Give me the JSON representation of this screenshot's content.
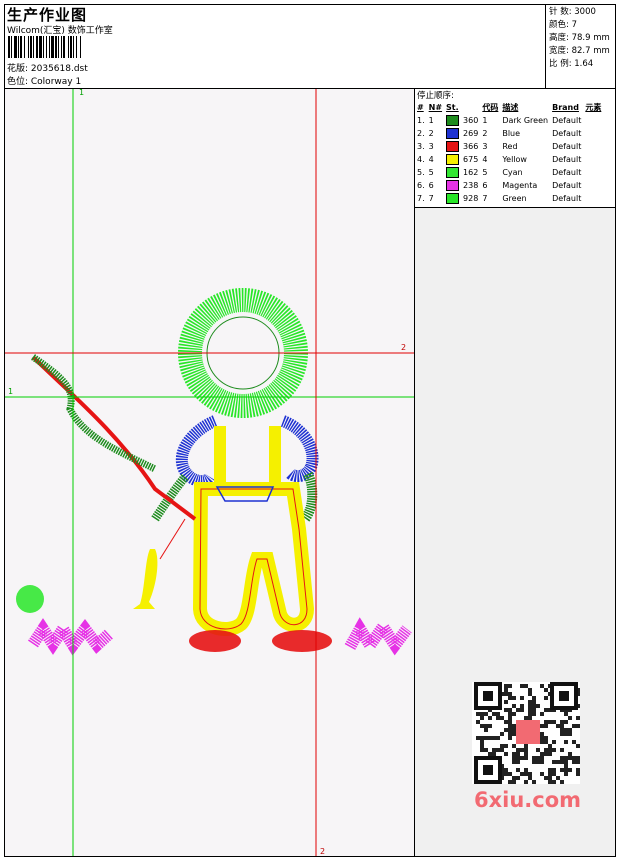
{
  "header": {
    "title": "生产作业图",
    "subtitle": "Wilcom(汇宝) 数饰工作室",
    "design_label": "花版: 2035618.dst",
    "colorway_label": "色位:  Colorway 1"
  },
  "stats": {
    "stitches": "针 数:  3000",
    "colors": "颜色:  7",
    "height": "高度:  78.9 mm",
    "width": "宽度:  82.7 mm",
    "ratio": "比 例:  1.64"
  },
  "panel": {
    "title": "停止顺序:",
    "headers": [
      "#",
      "N#",
      "St.",
      "代码",
      "描述",
      "Brand",
      "元素"
    ],
    "rows": [
      {
        "num": "1.",
        "n": "1",
        "st": "360",
        "code": "1",
        "desc": "Dark Green",
        "brand": "Default",
        "color": "#1e8c1e"
      },
      {
        "num": "2.",
        "n": "2",
        "st": "269",
        "code": "2",
        "desc": "Blue",
        "brand": "Default",
        "color": "#1e32d2"
      },
      {
        "num": "3.",
        "n": "3",
        "st": "366",
        "code": "3",
        "desc": "Red",
        "brand": "Default",
        "color": "#e61414"
      },
      {
        "num": "4.",
        "n": "4",
        "st": "675",
        "code": "4",
        "desc": "Yellow",
        "brand": "Default",
        "color": "#f5f000"
      },
      {
        "num": "5.",
        "n": "5",
        "st": "162",
        "code": "5",
        "desc": "Cyan",
        "brand": "Default",
        "color": "#32e632"
      },
      {
        "num": "6.",
        "n": "6",
        "st": "238",
        "code": "6",
        "desc": "Magenta",
        "brand": "Default",
        "color": "#e632e6"
      },
      {
        "num": "7.",
        "n": "7",
        "st": "928",
        "code": "7",
        "desc": "Green",
        "brand": "Default",
        "color": "#28e628"
      }
    ]
  },
  "guides": {
    "top_label": "1",
    "left_label": "1",
    "right_label": "2",
    "bottom_label": "2"
  },
  "watermark": {
    "site": "6xiu.com",
    "seal": "印章"
  }
}
